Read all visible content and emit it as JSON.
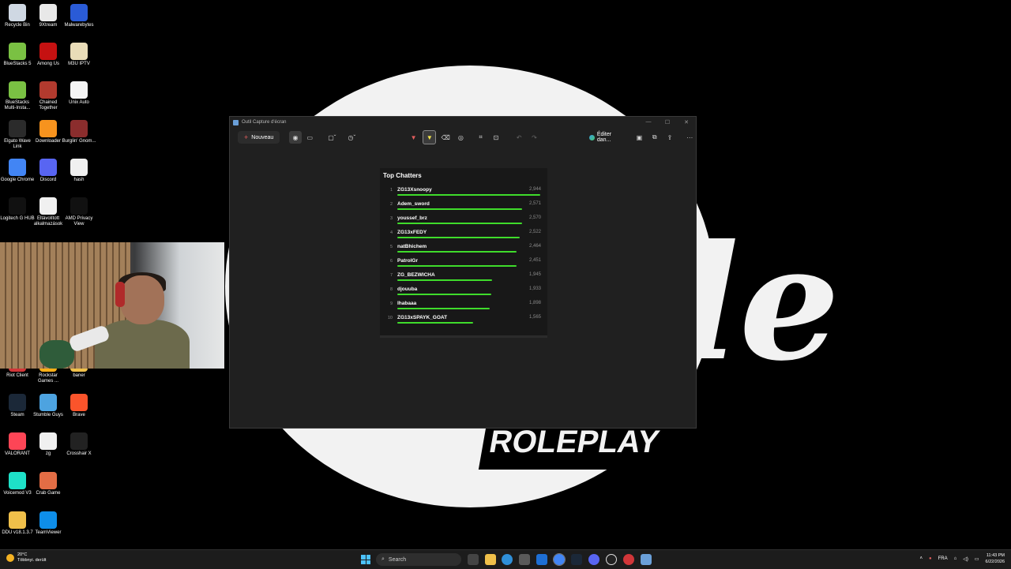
{
  "desktop": {
    "icons": [
      {
        "label": "Recycle Bin",
        "icon": "recycle-bin-icon",
        "color": "#cfd8e3"
      },
      {
        "label": "9Xtream",
        "icon": "9xtream-icon",
        "color": "#e8e8e8"
      },
      {
        "label": "Malwarebytes",
        "icon": "malwarebytes-icon",
        "color": "#2a5bd7"
      },
      {
        "label": "BlueStacks 5",
        "icon": "bluestacks-icon",
        "color": "#7ac143"
      },
      {
        "label": "Among Us",
        "icon": "among-us-icon",
        "color": "#c51111"
      },
      {
        "label": "M3U IPTV",
        "icon": "m3u-iptv-icon",
        "color": "#e9dcb8"
      },
      {
        "label": "BlueStacks Multi-Insta...",
        "icon": "bluestacks-multi-icon",
        "color": "#7ac143"
      },
      {
        "label": "Chained Together",
        "icon": "chained-together-icon",
        "color": "#b23a2e"
      },
      {
        "label": "Unix Auto",
        "icon": "unix-auto-icon",
        "color": "#f4f4f4"
      },
      {
        "label": "Elgato Wave Link",
        "icon": "elgato-wave-link-icon",
        "color": "#2b2b2b"
      },
      {
        "label": "Downloader",
        "icon": "downloader-icon",
        "color": "#f7931e"
      },
      {
        "label": "Burglin' Gnom...",
        "icon": "burglin-gnomes-icon",
        "color": "#8b2d2d"
      },
      {
        "label": "Google Chrome",
        "icon": "chrome-icon",
        "color": "#4285f4"
      },
      {
        "label": "Discord",
        "icon": "discord-icon",
        "color": "#5865f2"
      },
      {
        "label": "hash",
        "icon": "file-icon",
        "color": "#f0f0f0"
      },
      {
        "label": "Logitech G HUB",
        "icon": "logitech-g-hub-icon",
        "color": "#111111"
      },
      {
        "label": "Eltávolított alkalmazások",
        "icon": "chrome-shortcut-icon",
        "color": "#f0f0f0"
      },
      {
        "label": "AMD Privacy View",
        "icon": "amd-privacy-view-icon",
        "color": "#111111"
      },
      {
        "label": "Riot Client",
        "icon": "riot-client-icon",
        "color": "#d13639"
      },
      {
        "label": "Rockstar Games ...",
        "icon": "rockstar-games-icon",
        "color": "#fcaf17"
      },
      {
        "label": "baner",
        "icon": "folder-icon",
        "color": "#f0c04a"
      },
      {
        "label": "Steam",
        "icon": "steam-icon",
        "color": "#1b2838"
      },
      {
        "label": "Stumble Guys",
        "icon": "stumble-guys-icon",
        "color": "#4da3e0"
      },
      {
        "label": "Brave",
        "icon": "brave-icon",
        "color": "#fb542b"
      },
      {
        "label": "VALORANT",
        "icon": "valorant-icon",
        "color": "#fd4556"
      },
      {
        "label": "zg",
        "icon": "file-icon",
        "color": "#f0f0f0"
      },
      {
        "label": "Crosshair X",
        "icon": "crosshair-x-icon",
        "color": "#222222"
      },
      {
        "label": "Voicemod V3",
        "icon": "voicemod-icon",
        "color": "#1ee1c8"
      },
      {
        "label": "Crab Game",
        "icon": "crab-game-icon",
        "color": "#e36d45"
      },
      {
        "label": "DDU v18.1.3.7",
        "icon": "ddu-folder-icon",
        "color": "#f0c04a"
      },
      {
        "label": "TeamViewer",
        "icon": "teamviewer-icon",
        "color": "#0e8ee9"
      }
    ],
    "wallpaper_text": "ROLEPLAY",
    "wallpaper_script": "le"
  },
  "window": {
    "title": "Outil Capture d'écran",
    "new_button": "Nouveau",
    "edit_in": "Éditer dan..."
  },
  "top_chatters": {
    "title": "Top Chatters",
    "rows": [
      {
        "rank": "1",
        "name": "ZG13Xsnoopy",
        "count": "2,944",
        "value": 2944
      },
      {
        "rank": "2",
        "name": "Adem_sword",
        "count": "2,571",
        "value": 2571
      },
      {
        "rank": "3",
        "name": "youssef_brz",
        "count": "2,570",
        "value": 2570
      },
      {
        "rank": "4",
        "name": "ZG13xFEDY",
        "count": "2,522",
        "value": 2522
      },
      {
        "rank": "5",
        "name": "natBhichem",
        "count": "2,464",
        "value": 2464
      },
      {
        "rank": "6",
        "name": "PatrolGr",
        "count": "2,451",
        "value": 2451
      },
      {
        "rank": "7",
        "name": "ZG_BEZWICHA",
        "count": "1,945",
        "value": 1945
      },
      {
        "rank": "8",
        "name": "djouuba",
        "count": "1,933",
        "value": 1933
      },
      {
        "rank": "9",
        "name": "lhabaaa",
        "count": "1,898",
        "value": 1898
      },
      {
        "rank": "10",
        "name": "ZG13xSPAYK_GOAT",
        "count": "1,565",
        "value": 1565
      }
    ],
    "bar_color": "#3fdc2b"
  },
  "taskbar": {
    "weather_temp": "20°C",
    "weather_desc": "Többnyi. derült",
    "search_label": "Search",
    "language": "FRA",
    "time": "11:43 PM",
    "date": "6/22/2026"
  }
}
